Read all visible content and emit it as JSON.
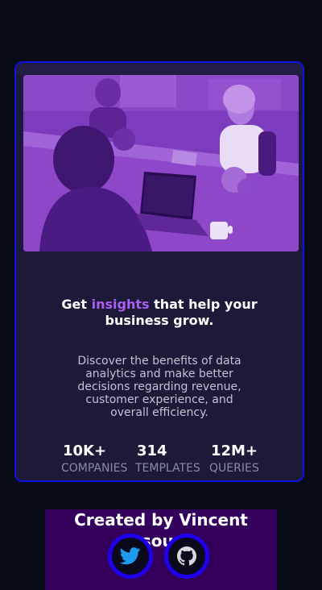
{
  "card": {
    "headline_before": "Get ",
    "headline_accent": "insights",
    "headline_after": " that help your business grow.",
    "description": "Discover the benefits of data analytics and make better decisions regarding revenue, customer experience, and overall efficiency.",
    "stats": [
      {
        "value": "10K+",
        "label": "COMPANIES"
      },
      {
        "value": "314",
        "label": "TEMPLATES"
      },
      {
        "value": "12M+",
        "label": "QUERIES"
      }
    ]
  },
  "footer": {
    "credit": "Created by Vincent Dsouza",
    "links": [
      {
        "icon": "twitter-icon"
      },
      {
        "icon": "github-icon"
      }
    ]
  },
  "colors": {
    "background": "#090b17",
    "card": "#1c1a38",
    "accent": "#a95ff0",
    "card_border": "#1111e8",
    "footer_bg": "#35005c",
    "social_ring": "#1e00ee",
    "twitter_blue": "#1d9bf0"
  }
}
